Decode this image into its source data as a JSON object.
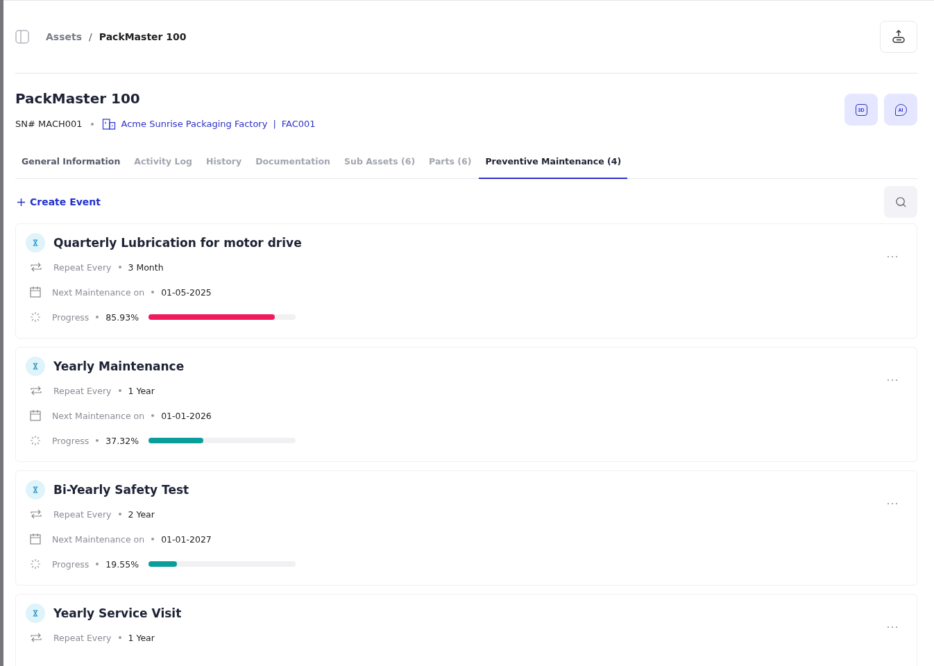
{
  "breadcrumb": {
    "parent": "Assets",
    "separator": "/",
    "current": "PackMaster 100"
  },
  "asset": {
    "name": "PackMaster 100",
    "serial": "SN# MACH001",
    "site": "Acme Sunrise Packaging Factory",
    "site_separator": "|",
    "site_code": "FAC001"
  },
  "view_buttons": [
    {
      "label": "3D"
    },
    {
      "label": "AI"
    }
  ],
  "tabs": [
    {
      "label": "General Information",
      "selected": false,
      "muted": false
    },
    {
      "label": "Activity Log",
      "selected": false,
      "muted": true
    },
    {
      "label": "History",
      "selected": false,
      "muted": true
    },
    {
      "label": "Documentation",
      "selected": false,
      "muted": true
    },
    {
      "label": "Sub Assets (6)",
      "selected": false,
      "muted": true
    },
    {
      "label": "Parts (6)",
      "selected": false,
      "muted": true
    },
    {
      "label": "Preventive Maintenance (4)",
      "selected": true,
      "muted": false
    }
  ],
  "create_button": "Create Event",
  "events": [
    {
      "title": "Quarterly Lubrication for motor drive",
      "rows": [
        {
          "kind": "repeat",
          "label": "Repeat Every",
          "value": "3 Month"
        },
        {
          "kind": "date",
          "label": "Next Maintenance on",
          "value": "01-05-2025"
        },
        {
          "kind": "progress",
          "label": "Progress",
          "value": "85.93%",
          "level": 0.8593,
          "color": "#f0195b"
        }
      ]
    },
    {
      "title": "Yearly Maintenance",
      "rows": [
        {
          "kind": "repeat",
          "label": "Repeat Every",
          "value": "1 Year"
        },
        {
          "kind": "date",
          "label": "Next Maintenance on",
          "value": "01-01-2026"
        },
        {
          "kind": "progress",
          "label": "Progress",
          "value": "37.32%",
          "level": 0.3732,
          "color": "#0a9e9b"
        }
      ]
    },
    {
      "title": "Bi-Yearly Safety Test",
      "rows": [
        {
          "kind": "repeat",
          "label": "Repeat Every",
          "value": "2 Year"
        },
        {
          "kind": "date",
          "label": "Next Maintenance on",
          "value": "01-01-2027"
        },
        {
          "kind": "progress",
          "label": "Progress",
          "value": "19.55%",
          "level": 0.1955,
          "color": "#0a9e9b"
        }
      ]
    },
    {
      "title": "Yearly Service Visit",
      "rows": [
        {
          "kind": "repeat",
          "label": "Repeat Every",
          "value": "1 Year"
        }
      ]
    }
  ]
}
